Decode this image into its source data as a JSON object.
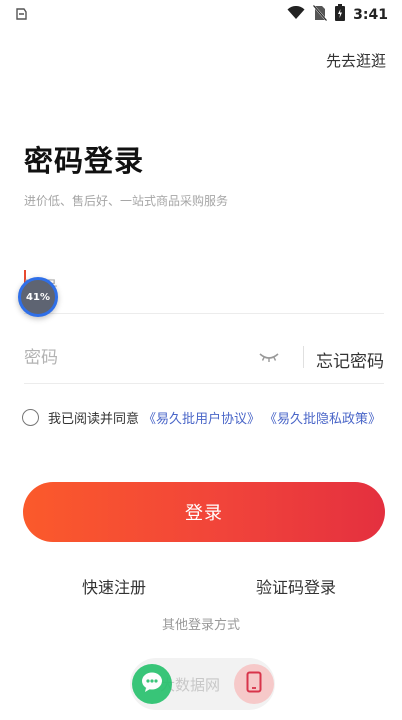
{
  "status_bar": {
    "time": "3:41"
  },
  "header": {
    "skip_label": "先去逛逛"
  },
  "login": {
    "title": "密码登录",
    "subtitle": "进价低、售后好、一站式商品采购服务",
    "account_placeholder": "账号",
    "password_placeholder": "密码",
    "forgot_label": "忘记密码",
    "progress_badge": "41%",
    "agreement_text": "我已阅读并同意",
    "user_agreement_link": "《易久批用户协议》",
    "privacy_link": "《易久批隐私政策》",
    "login_button_label": "登录",
    "register_label": "快速注册",
    "sms_login_label": "验证码登录",
    "other_methods_label": "其他登录方式",
    "watermark_text": "大数据网"
  },
  "colors": {
    "accent_start": "#fb5a2b",
    "accent_end": "#e4303f",
    "link": "#4a66c8",
    "wechat": "#24c16b"
  },
  "icons": [
    "signal-icon",
    "wifi-icon",
    "no-sim-icon",
    "battery-icon",
    "eye-closed-icon",
    "wechat-icon",
    "phone-icon"
  ]
}
